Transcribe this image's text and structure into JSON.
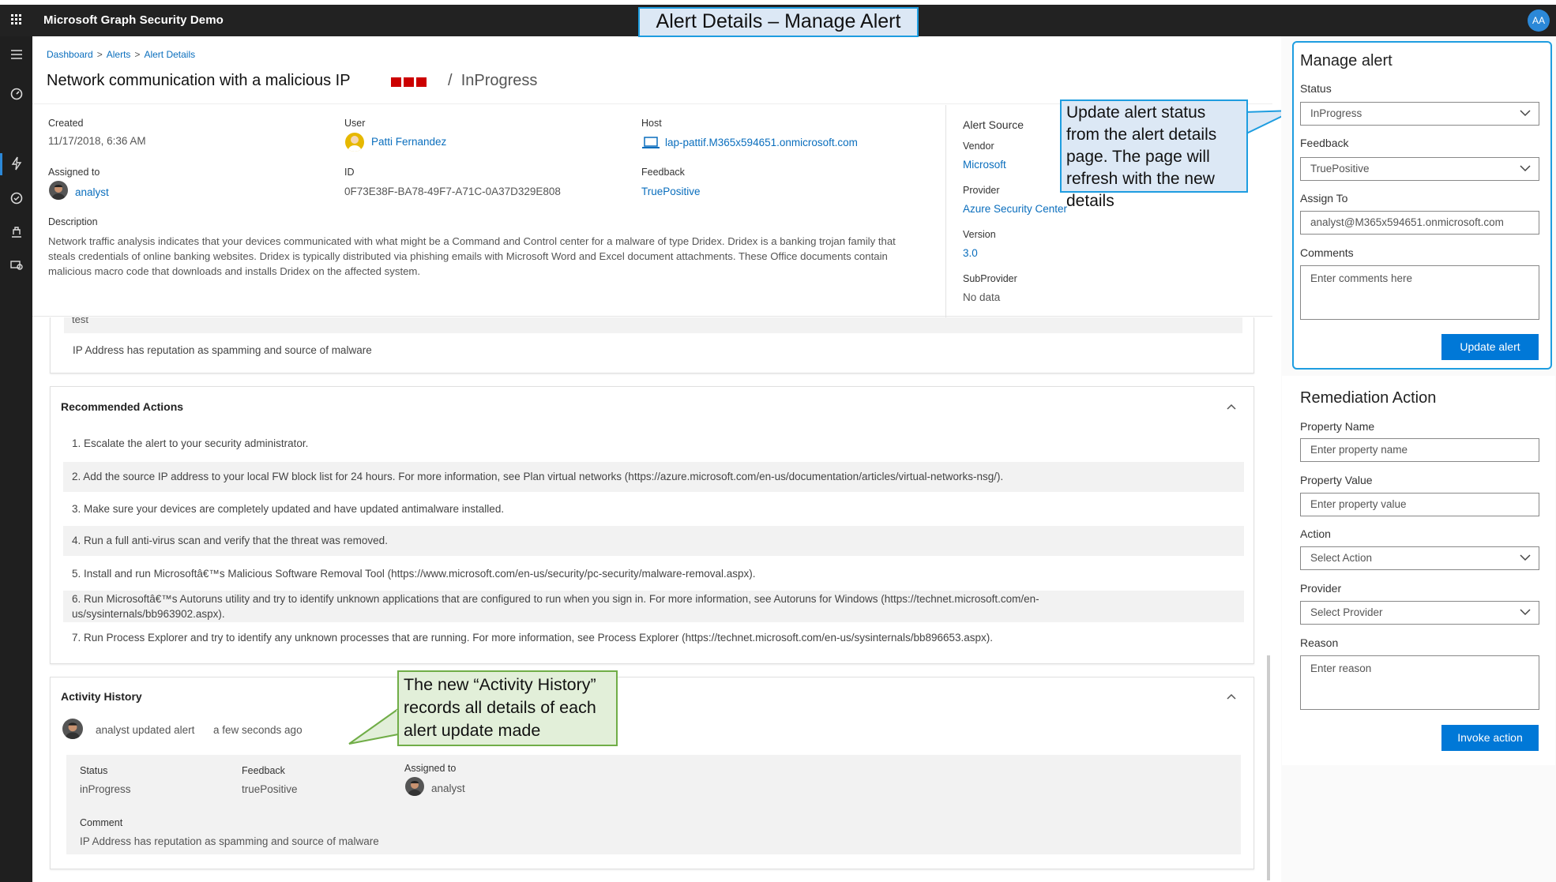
{
  "app": {
    "title": "Microsoft Graph Security Demo",
    "user_initials": "AA"
  },
  "callouts": {
    "title": "Alert Details – Manage Alert",
    "update": "Update alert status from the alert details page. The page will refresh with the new details",
    "history": "The new “Activity History” records all details of each alert update made"
  },
  "breadcrumb": {
    "items": [
      "Dashboard",
      "Alerts",
      "Alert Details"
    ],
    "sep": ">"
  },
  "alert": {
    "title": "Network communication with a malicious IP",
    "status_sep": "/",
    "status": "InProgress",
    "created_label": "Created",
    "created": "11/17/2018, 6:36 AM",
    "user_label": "User",
    "user": "Patti Fernandez",
    "host_label": "Host",
    "host": "lap-pattif.M365x594651.onmicrosoft.com",
    "assigned_label": "Assigned to",
    "assigned": "analyst",
    "id_label": "ID",
    "id": "0F73E38F-BA78-49F7-A71C-0A37D329E808",
    "feedback_label": "Feedback",
    "feedback": "TruePositive",
    "description_label": "Description",
    "description": "Network traffic analysis indicates that your devices communicated with what might be a Command and Control center for a malware of type Dridex. Dridex is a banking trojan family that steals credentials of online banking websites. Dridex is typically distributed via phishing emails with Microsoft Word and Excel document attachments. These Office documents contain malicious macro code that downloads and installs Dridex on the affected system."
  },
  "source": {
    "title": "Alert Source",
    "vendor_label": "Vendor",
    "vendor": "Microsoft",
    "provider_label": "Provider",
    "provider": "Azure Security Center",
    "version_label": "Version",
    "version": "3.0",
    "subprovider_label": "SubProvider",
    "subprovider": "No data"
  },
  "comments_card": {
    "partial": "test",
    "comment": "IP Address has reputation as spamming and source of malware"
  },
  "recommended": {
    "title": "Recommended Actions",
    "items": [
      "1. Escalate the alert to your security administrator.",
      "2. Add the source IP address to your local FW block list for 24 hours. For more information, see Plan virtual networks (https://azure.microsoft.com/en-us/documentation/articles/virtual-networks-nsg/).",
      "3. Make sure your devices are completely updated and have updated antimalware installed.",
      "4. Run a full anti-virus scan and verify that the threat was removed.",
      "5. Install and run Microsoftâ€™s Malicious Software Removal Tool (https://www.microsoft.com/en-us/security/pc-security/malware-removal.aspx).",
      "6. Run Microsoftâ€™s Autoruns utility and try to identify unknown applications that are configured to run when you sign in. For more information, see Autoruns for Windows (https://technet.microsoft.com/en-us/sysinternals/bb963902.aspx).",
      "7. Run Process Explorer and try to identify any unknown processes that are running. For more information, see Process Explorer (https://technet.microsoft.com/en-us/sysinternals/bb896653.aspx)."
    ]
  },
  "activity": {
    "title": "Activity History",
    "entry_text": "analyst updated alert",
    "entry_time": "a few seconds ago",
    "status_label": "Status",
    "status": "inProgress",
    "feedback_label": "Feedback",
    "feedback": "truePositive",
    "assigned_label": "Assigned to",
    "assigned": "analyst",
    "comment_label": "Comment",
    "comment": "IP Address has reputation as spamming and source of malware"
  },
  "manage": {
    "title": "Manage alert",
    "status_label": "Status",
    "status_value": "InProgress",
    "feedback_label": "Feedback",
    "feedback_value": "TruePositive",
    "assign_label": "Assign To",
    "assign_value": "analyst@M365x594651.onmicrosoft.com",
    "comments_label": "Comments",
    "comments_placeholder": "Enter comments here",
    "update_button": "Update alert"
  },
  "remediation": {
    "title": "Remediation Action",
    "prop_name_label": "Property Name",
    "prop_name_placeholder": "Enter property name",
    "prop_value_label": "Property Value",
    "prop_value_placeholder": "Enter property value",
    "action_label": "Action",
    "action_value": "Select Action",
    "provider_label": "Provider",
    "provider_value": "Select Provider",
    "reason_label": "Reason",
    "reason_placeholder": "Enter reason",
    "invoke_button": "Invoke action"
  },
  "colors": {
    "accent": "#0078d7",
    "severity": "#cc0000",
    "callout_blue": "#dce8f5",
    "callout_green": "#e2efd9"
  }
}
